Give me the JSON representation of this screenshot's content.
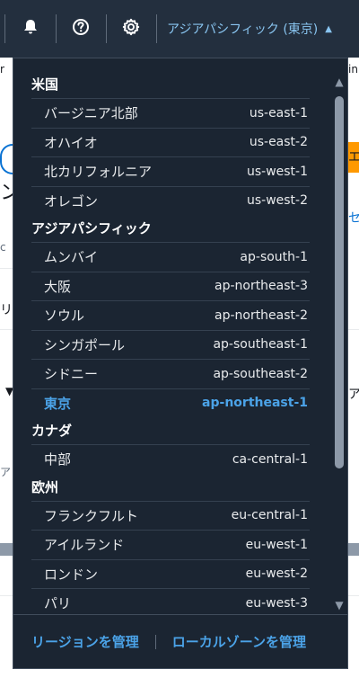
{
  "topbar": {
    "region_label": "アジアパシフィック (東京)"
  },
  "background": {
    "snippets": [
      "r",
      "in",
      "エ",
      "c",
      "リ",
      "ア",
      "ア",
      "ン",
      "セ"
    ]
  },
  "region_menu": {
    "groups": [
      {
        "name": "米国",
        "regions": [
          {
            "name": "バージニア北部",
            "code": "us-east-1"
          },
          {
            "name": "オハイオ",
            "code": "us-east-2"
          },
          {
            "name": "北カリフォルニア",
            "code": "us-west-1"
          },
          {
            "name": "オレゴン",
            "code": "us-west-2"
          }
        ]
      },
      {
        "name": "アジアパシフィック",
        "regions": [
          {
            "name": "ムンバイ",
            "code": "ap-south-1"
          },
          {
            "name": "大阪",
            "code": "ap-northeast-3"
          },
          {
            "name": "ソウル",
            "code": "ap-northeast-2"
          },
          {
            "name": "シンガポール",
            "code": "ap-southeast-1"
          },
          {
            "name": "シドニー",
            "code": "ap-southeast-2"
          },
          {
            "name": "東京",
            "code": "ap-northeast-1",
            "selected": true
          }
        ]
      },
      {
        "name": "カナダ",
        "regions": [
          {
            "name": "中部",
            "code": "ca-central-1"
          }
        ]
      },
      {
        "name": "欧州",
        "regions": [
          {
            "name": "フランクフルト",
            "code": "eu-central-1"
          },
          {
            "name": "アイルランド",
            "code": "eu-west-1"
          },
          {
            "name": "ロンドン",
            "code": "eu-west-2"
          },
          {
            "name": "パリ",
            "code": "eu-west-3"
          }
        ]
      }
    ],
    "footer": {
      "manage_regions": "リージョンを管理",
      "manage_local_zones": "ローカルゾーンを管理"
    }
  },
  "colors": {
    "nav_bg": "#232f3e",
    "menu_bg": "#1b2532",
    "accent": "#4ba3e8",
    "badge_orange": "#ff9900"
  }
}
